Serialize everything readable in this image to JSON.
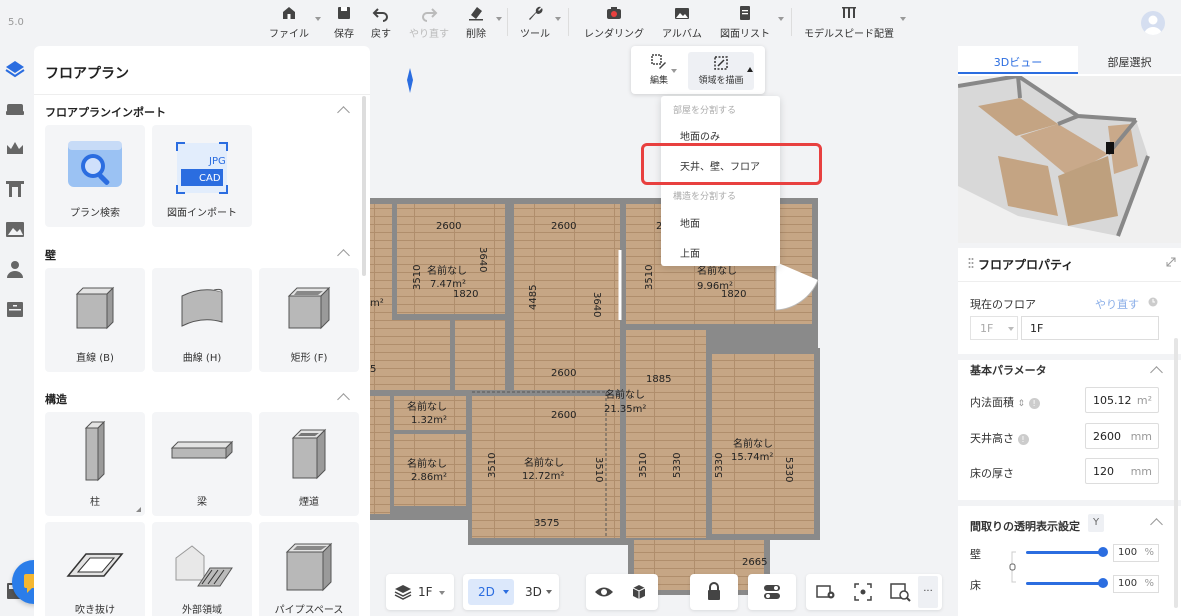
{
  "version": "5.0",
  "toolbar": {
    "file": "ファイル",
    "save": "保存",
    "undo": "戻す",
    "redo": "やり直す",
    "delete": "削除",
    "tools": "ツール",
    "rendering": "レンダリング",
    "album": "アルバム",
    "drawing_list": "図面リスト",
    "model_speed": "モデルスピード配置"
  },
  "left_panel": {
    "title": "フロアプラン",
    "sections": {
      "import": "フロアプランインポート",
      "wall": "壁",
      "structure": "構造"
    },
    "import_items": [
      "プラン検索",
      "図面インポート"
    ],
    "import_badges": {
      "jpg": "JPG",
      "cad": "CAD"
    },
    "wall_items": [
      "直線 (B)",
      "曲線 (H)",
      "矩形 (F)"
    ],
    "structure_items": [
      "柱",
      "梁",
      "煙道",
      "吹き抜け",
      "外部領域",
      "パイプスペース"
    ]
  },
  "draw_menu": {
    "edit": "編集",
    "draw_area": "領域を描画"
  },
  "submenu": {
    "header_room": "部屋を分割する",
    "floor_only": "地面のみ",
    "ceiling_wall_floor": "天井、壁、フロア",
    "header_structure": "構造を分割する",
    "ground": "地面",
    "top": "上面"
  },
  "floorplan": {
    "rooms": [
      {
        "name": "名前なし",
        "area": "7.47m²"
      },
      {
        "name": "名前なし",
        "area": "9.96m²"
      },
      {
        "name": "名前なし",
        "area": "21.35m²"
      },
      {
        "name": "名前なし",
        "area": "1.32m²"
      },
      {
        "name": "名前なし",
        "area": "2.86m²"
      },
      {
        "name": "名前なし",
        "area": "12.72m²"
      },
      {
        "name": "名前なし",
        "area": "15.74m²"
      }
    ],
    "dims": [
      "2600",
      "2600",
      "2600",
      "3510",
      "4485",
      "3640",
      "1820",
      "3510",
      "1820",
      "2600",
      "1885",
      "2600",
      "3510",
      "3510",
      "3510",
      "5330",
      "5330",
      "5330",
      "3575",
      "2665",
      "5",
      "m²"
    ]
  },
  "right_panel": {
    "tabs": [
      "3Dビュー",
      "部屋選択"
    ],
    "props_title": "フロアプロパティ",
    "current_floor_label": "現在のフロア",
    "redo_label": "やり直す",
    "floor_select": "1F",
    "floor_name": "1F",
    "basic_params": "基本パラメータ",
    "area_label": "内法面積",
    "area_value": "105.12",
    "area_unit": "m²",
    "ceiling_label": "天井高さ",
    "ceiling_value": "2600",
    "ceiling_unit": "mm",
    "floor_thick_label": "床の厚さ",
    "floor_thick_value": "120",
    "floor_thick_unit": "mm",
    "transparency_title": "間取りの透明表示設定",
    "transparency_badge": "Y",
    "wall_label": "壁",
    "wall_value": "100",
    "floor_label": "床",
    "floor_value": "100",
    "percent": "%",
    "wall_slider": 1.0,
    "floor_slider": 1.0
  },
  "bottom": {
    "floor": "1F",
    "mode_2d": "2D",
    "mode_3d": "3D",
    "more": "···"
  },
  "colors": {
    "accent": "#2b6de0",
    "highlight": "#e8403f",
    "wood": "#c9a98a"
  }
}
